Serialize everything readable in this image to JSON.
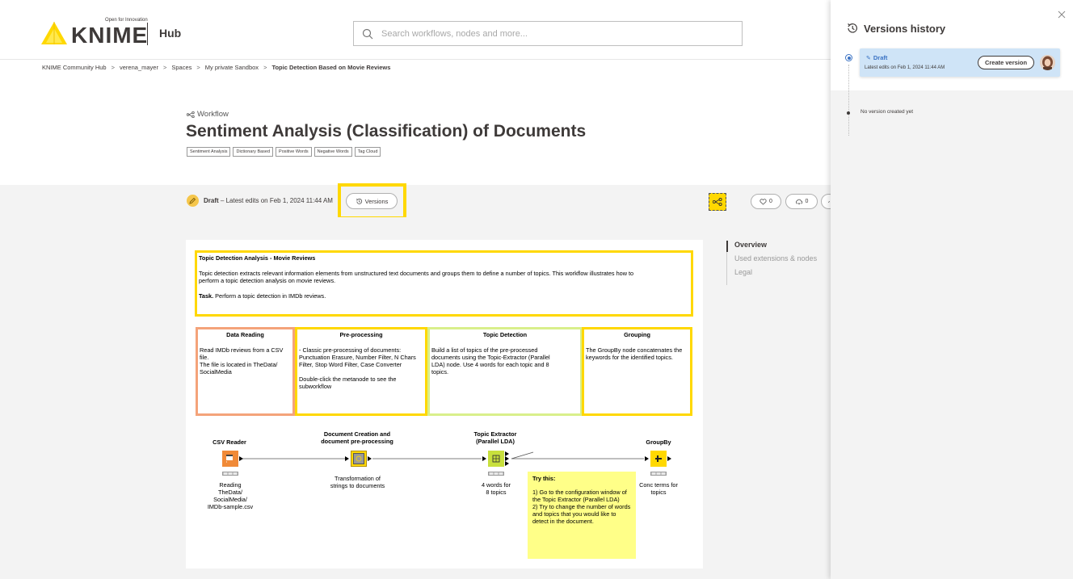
{
  "header": {
    "logo_tagline": "Open for Innovation",
    "logo_word": "KNIME",
    "hub_label": "Hub",
    "search_placeholder": "Search workflows, nodes and more..."
  },
  "breadcrumb": [
    "KNIME Community Hub",
    "verena_mayer",
    "Spaces",
    "My private Sandbox",
    "Topic Detection Based on Movie Reviews"
  ],
  "breadcrumb_separator": ">",
  "workflow": {
    "type_label": "Workflow",
    "title": "Sentiment Analysis (Classification) of Documents",
    "tags": [
      "Sentiment Analysis",
      "Dictionary Based",
      "Positive Words",
      "Negative Words",
      "Tag Cloud"
    ]
  },
  "version_bar": {
    "draft_label": "Draft",
    "draft_meta": "– Latest edits on Feb 1, 2024 11:44 AM",
    "versions_button": "Versions",
    "likes_count": "0",
    "downloads_count": "0"
  },
  "side_nav": [
    "Overview",
    "Used extensions & nodes",
    "Legal"
  ],
  "canvas": {
    "intro": {
      "heading": "Topic Detection Analysis - Movie Reviews",
      "body": "Topic detection extracts relevant information elements from unstructured text documents and groups them to define a number of topics. This workflow illustrates how to perform a topic detection analysis on movie reviews.",
      "task_label": "Task.",
      "task_text": " Perform a topic detection in IMDb reviews."
    },
    "sections": [
      {
        "heading": "Data Reading",
        "text": "Read IMDb reviews from a CSV file.\nThe file is located in TheData/ SocialMedia",
        "color": "#f4a37a"
      },
      {
        "heading": "Pre-processing",
        "text": "- Classic pre-processing of documents: Punctuation Erasure, Number Filter, N Chars Filter, Stop Word Filter, Case Converter\n\nDouble-click the metanode to see the subworkflow",
        "color": "#ffd800"
      },
      {
        "heading": "Topic Detection",
        "text": "Build a list of topics of the pre-processed documents using the Topic-Extractor (Parallel LDA) node. Use 4 words for each topic and 8 topics.",
        "color": "#d9ef8b"
      },
      {
        "heading": "Grouping",
        "text": "The GroupBy node concatenates the keywords for the identified topics.",
        "color": "#ffd800"
      }
    ],
    "nodes": [
      {
        "title": "CSV Reader",
        "caption": "Reading\nTheData/\nSocialMedia/\nIMDb-sample.csv"
      },
      {
        "title": "Document Creation and\ndocument pre-processing",
        "caption": "Transformation of\nstrings to documents"
      },
      {
        "title": "Topic Extractor\n(Parallel LDA)",
        "caption": "4 words for\n8 topics"
      },
      {
        "title": "GroupBy",
        "caption": "Conc terms for\ntopics"
      }
    ],
    "sticky": {
      "heading": "Try this:",
      "text": "1) Go to the configuration window of the Topic Extractor (Parallel LDA)\n2) Try to change the number of words and topics that you would like to detect in the document."
    }
  },
  "panel": {
    "title": "Versions history",
    "draft_name": "Draft",
    "draft_meta": "Latest edits on Feb 1, 2024 11:44 AM",
    "create_button": "Create version",
    "no_version_text": "No version created yet"
  },
  "colors": {
    "accent_yellow": "#ffd800",
    "selected_blue": "#3b73c4",
    "card_blue": "#cfe4f7"
  }
}
